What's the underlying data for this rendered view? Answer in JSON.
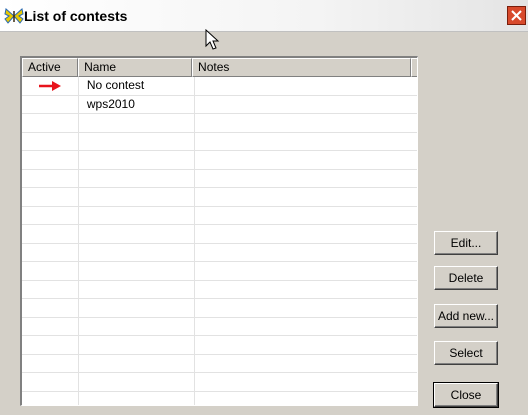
{
  "window": {
    "title": "List of contests"
  },
  "table": {
    "columns": [
      "Active",
      "Name",
      "Notes"
    ],
    "rows": [
      {
        "active": true,
        "name": "No contest",
        "notes": ""
      },
      {
        "active": false,
        "name": "wps2010",
        "notes": ""
      }
    ],
    "empty_rows": 16
  },
  "buttons": {
    "edit": "Edit...",
    "delete": "Delete",
    "add_new": "Add new...",
    "select": "Select",
    "close": "Close"
  },
  "colors": {
    "active_arrow": "#e8141c",
    "close_button": "#d84a2c"
  },
  "icons": {
    "app": "butterfly-icon",
    "active_marker": "arrow-right-icon",
    "close": "close-icon"
  }
}
